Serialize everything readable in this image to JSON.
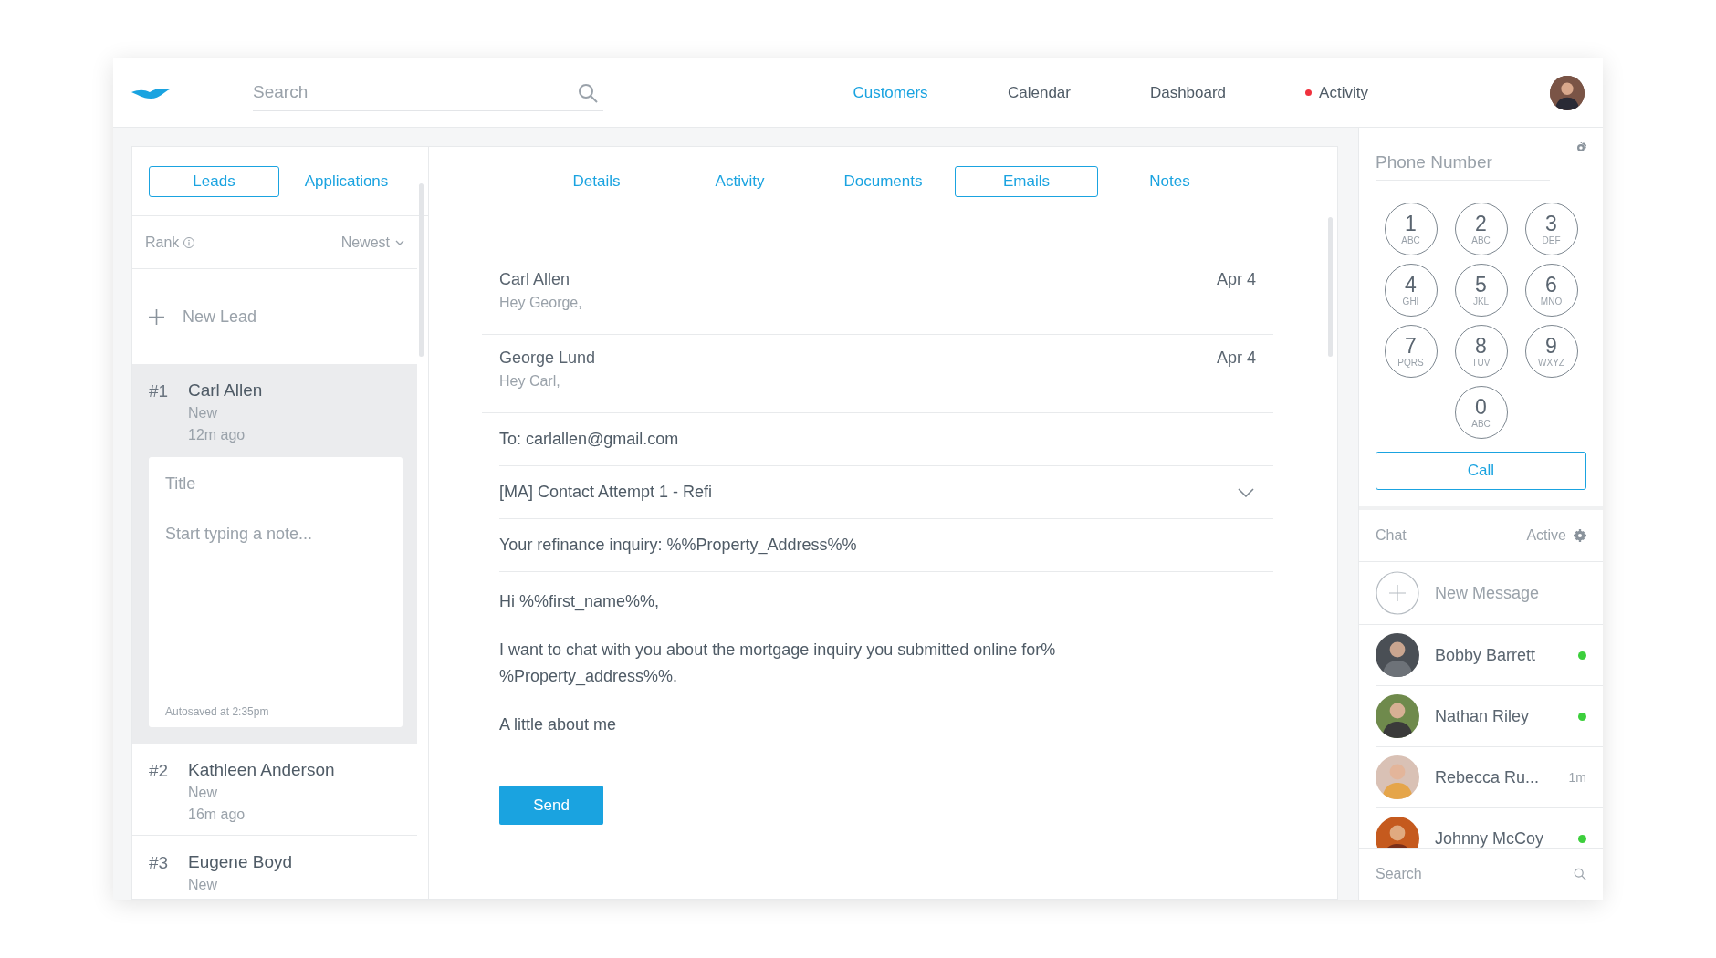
{
  "top_bar": {
    "search": {
      "placeholder": "Search"
    },
    "nav": [
      {
        "label": "Customers",
        "selected": true,
        "notification": false
      },
      {
        "label": "Calendar",
        "selected": false,
        "notification": false
      },
      {
        "label": "Dashboard",
        "selected": false,
        "notification": false
      },
      {
        "label": "Activity",
        "selected": false,
        "notification": true
      }
    ]
  },
  "leads_panel": {
    "tabs": [
      {
        "label": "Leads",
        "selected": true
      },
      {
        "label": "Applications",
        "selected": false
      }
    ],
    "sort": {
      "label": "Rank",
      "order": "Newest"
    },
    "new_lead": "New Lead",
    "leads": [
      {
        "rank": "#1",
        "name": "Carl Allen",
        "status": "New",
        "time": "12m ago",
        "selected": true,
        "note": {
          "title_placeholder": "Title",
          "body_placeholder": "Start typing a note...",
          "autosave": "Autosaved at 2:35pm"
        }
      },
      {
        "rank": "#2",
        "name": "Kathleen Anderson",
        "status": "New",
        "time": "16m ago",
        "selected": false
      },
      {
        "rank": "#3",
        "name": "Eugene Boyd",
        "status": "New",
        "selected": false
      }
    ]
  },
  "detail_panel": {
    "tabs": [
      {
        "label": "Details",
        "selected": false
      },
      {
        "label": "Activity",
        "selected": false
      },
      {
        "label": "Documents",
        "selected": false
      },
      {
        "label": "Emails",
        "selected": true
      },
      {
        "label": "Notes",
        "selected": false
      }
    ],
    "emails": [
      {
        "sender": "Carl Allen",
        "preview": "Hey George,",
        "date": "Apr 4"
      },
      {
        "sender": "George Lund",
        "preview": "Hey Carl,",
        "date": "Apr 4"
      }
    ],
    "compose": {
      "to": "To: carlallen@gmail.com",
      "template": "[MA] Contact Attempt 1 - Refi",
      "subject": "Your refinance inquiry: %%Property_Address%%",
      "body": [
        "Hi %%first_name%%,",
        "I want to chat with you about the mortgage inquiry you submitted online for%\n%Property_address%%.",
        "A little about me"
      ],
      "send": "Send"
    }
  },
  "phone_panel": {
    "phone": {
      "placeholder": "Phone Number"
    },
    "keys": [
      {
        "digit": "1",
        "letters": "ABC"
      },
      {
        "digit": "2",
        "letters": "ABC"
      },
      {
        "digit": "3",
        "letters": "DEF"
      },
      {
        "digit": "4",
        "letters": "GHI"
      },
      {
        "digit": "5",
        "letters": "JKL"
      },
      {
        "digit": "6",
        "letters": "MNO"
      },
      {
        "digit": "7",
        "letters": "PQRS"
      },
      {
        "digit": "8",
        "letters": "TUV"
      },
      {
        "digit": "9",
        "letters": "WXYZ"
      },
      {
        "digit": "0",
        "letters": "ABC"
      }
    ],
    "call": "Call"
  },
  "chat_panel": {
    "title": "Chat",
    "status": "Active",
    "new_message": "New Message",
    "contacts": [
      {
        "name": "Bobby Barrett",
        "online": true
      },
      {
        "name": "Nathan Riley",
        "online": true
      },
      {
        "name": "Rebecca Ru...",
        "online": false,
        "time": "1m"
      },
      {
        "name": "Johnny McCoy",
        "online": true
      }
    ],
    "search": {
      "placeholder": "Search"
    }
  }
}
